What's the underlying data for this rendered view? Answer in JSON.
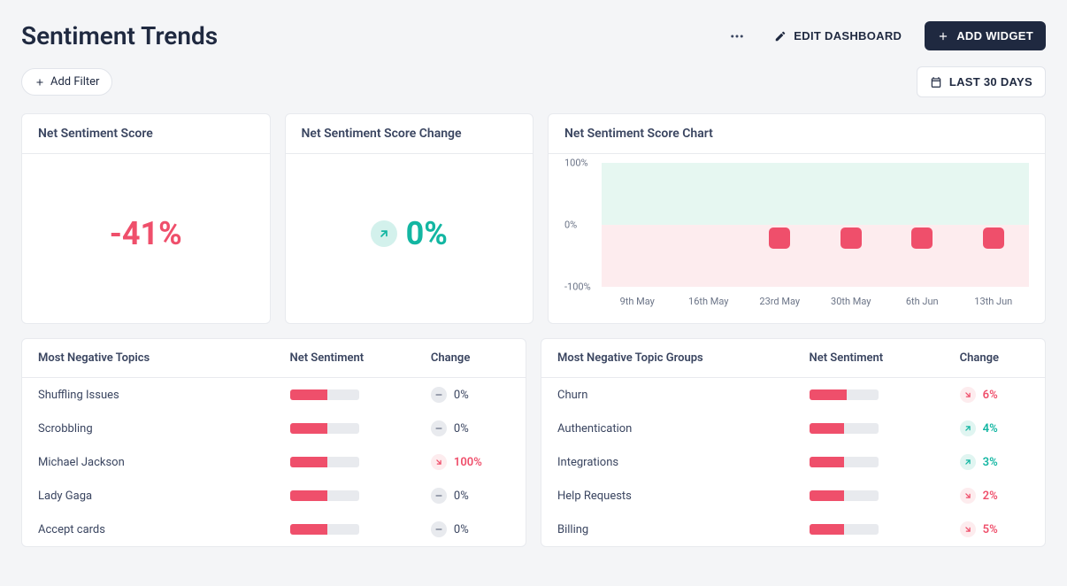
{
  "header": {
    "title": "Sentiment Trends",
    "edit_label": "EDIT DASHBOARD",
    "add_widget_label": "ADD WIDGET"
  },
  "filters": {
    "add_filter_label": "Add Filter",
    "date_range_label": "LAST 30 DAYS"
  },
  "score_card": {
    "title": "Net Sentiment Score",
    "value": "-41%"
  },
  "change_card": {
    "title": "Net Sentiment Score Change",
    "value": "0%"
  },
  "chart_card": {
    "title": "Net Sentiment Score Chart"
  },
  "chart_data": {
    "type": "bar",
    "categories": [
      "9th May",
      "16th May",
      "23rd May",
      "30th May",
      "6th Jun",
      "13th Jun"
    ],
    "values": [
      null,
      null,
      -20,
      -20,
      -20,
      -20
    ],
    "ylabel": "",
    "ylim": [
      -100,
      100
    ],
    "y_ticks": [
      "100%",
      "0%",
      "-100%"
    ]
  },
  "neg_topics": {
    "title": "Most Negative Topics",
    "col_sentiment": "Net Sentiment",
    "col_change": "Change",
    "rows": [
      {
        "label": "Shuffling Issues",
        "fill": 55,
        "change_dir": "neutral",
        "change": "0%"
      },
      {
        "label": "Scrobbling",
        "fill": 55,
        "change_dir": "neutral",
        "change": "0%"
      },
      {
        "label": "Michael Jackson",
        "fill": 55,
        "change_dir": "down",
        "change": "100%"
      },
      {
        "label": "Lady Gaga",
        "fill": 55,
        "change_dir": "neutral",
        "change": "0%"
      },
      {
        "label": "Accept cards",
        "fill": 55,
        "change_dir": "neutral",
        "change": "0%"
      }
    ]
  },
  "neg_groups": {
    "title": "Most Negative Topic Groups",
    "col_sentiment": "Net Sentiment",
    "col_change": "Change",
    "rows": [
      {
        "label": "Churn",
        "fill": 55,
        "change_dir": "down",
        "change": "6%"
      },
      {
        "label": "Authentication",
        "fill": 50,
        "change_dir": "up",
        "change": "4%"
      },
      {
        "label": "Integrations",
        "fill": 50,
        "change_dir": "up",
        "change": "3%"
      },
      {
        "label": "Help Requests",
        "fill": 50,
        "change_dir": "down",
        "change": "2%"
      },
      {
        "label": "Billing",
        "fill": 50,
        "change_dir": "down",
        "change": "5%"
      }
    ]
  }
}
